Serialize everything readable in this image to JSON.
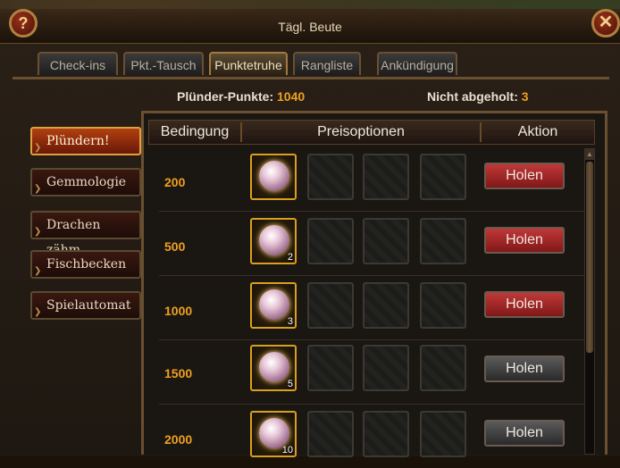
{
  "window": {
    "title": "Tägl. Beute",
    "help_label": "?",
    "close_label": "✕"
  },
  "tabs": [
    {
      "label": "Check-ins",
      "active": false
    },
    {
      "label": "Pkt.-Tausch",
      "active": false
    },
    {
      "label": "Punktetruhe",
      "active": true
    },
    {
      "label": "Rangliste",
      "active": false
    },
    {
      "label": "Ankündigung",
      "active": false
    }
  ],
  "stats": {
    "points_label": "Plünder-Punkte:",
    "points_value": "1040",
    "unclaimed_label": "Nicht abgeholt:",
    "unclaimed_value": "3"
  },
  "sidebar": {
    "items": [
      {
        "label": "Plündern!",
        "active": true
      },
      {
        "label": "Gemmologie",
        "active": false
      },
      {
        "label": "Drachen zähm.",
        "active": false
      },
      {
        "label": "Fischbecken",
        "active": false
      },
      {
        "label": "Spielautomat",
        "active": false
      }
    ]
  },
  "table": {
    "headers": {
      "condition": "Bedingung",
      "prizes": "Preisoptionen",
      "action": "Aktion"
    },
    "rows": [
      {
        "condition": "200",
        "qty": "",
        "action": "Holen",
        "claimable": true,
        "icon": "pearl-icon"
      },
      {
        "condition": "500",
        "qty": "2",
        "action": "Holen",
        "claimable": true,
        "icon": "pearl-icon"
      },
      {
        "condition": "1000",
        "qty": "3",
        "action": "Holen",
        "claimable": true,
        "icon": "pearl-icon"
      },
      {
        "condition": "1500",
        "qty": "5",
        "action": "Holen",
        "claimable": false,
        "icon": "pearl-icon"
      },
      {
        "condition": "2000",
        "qty": "10",
        "action": "Holen",
        "claimable": false,
        "icon": "pearl-icon"
      }
    ]
  },
  "colors": {
    "accent": "#f0a020",
    "claim_button": "#c03838",
    "disabled_button": "#5a5a5a"
  }
}
